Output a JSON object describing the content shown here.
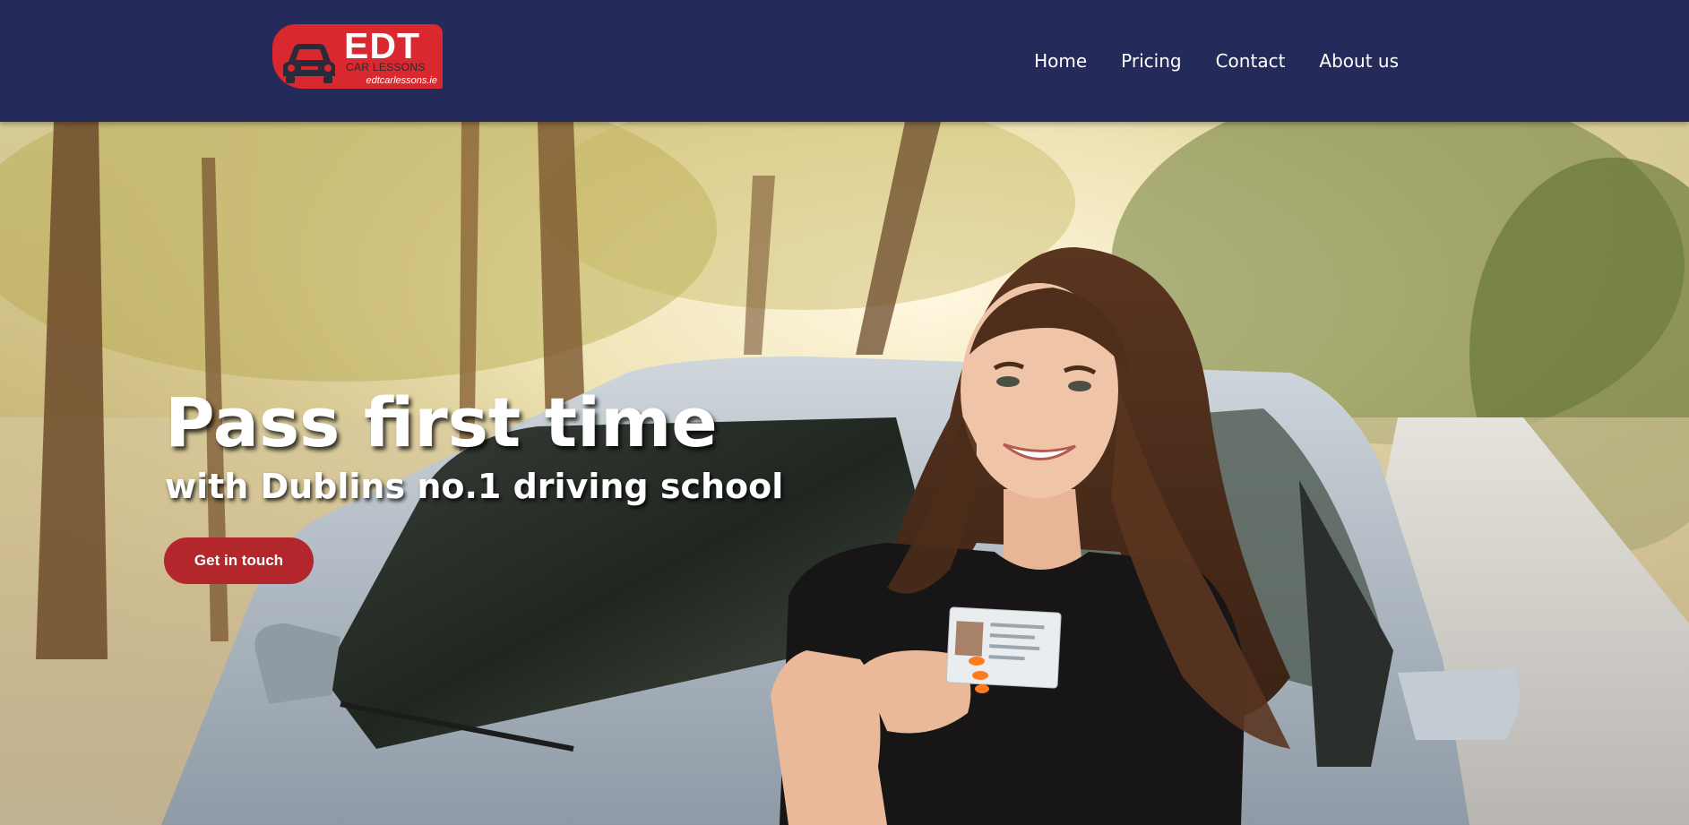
{
  "brand": {
    "logo_main": "EDT",
    "logo_sub": "CAR LESSONS",
    "logo_url": "edtcarlessons.ie",
    "color": "#d9282f"
  },
  "nav": {
    "items": [
      {
        "label": "Home"
      },
      {
        "label": "Pricing"
      },
      {
        "label": "Contact"
      },
      {
        "label": "About us"
      }
    ]
  },
  "hero": {
    "title": "Pass first time",
    "subtitle": "with Dublins no.1 driving school",
    "cta_label": "Get in touch",
    "cta_color": "#b3262b"
  },
  "theme": {
    "header_bg": "#242a5a"
  }
}
